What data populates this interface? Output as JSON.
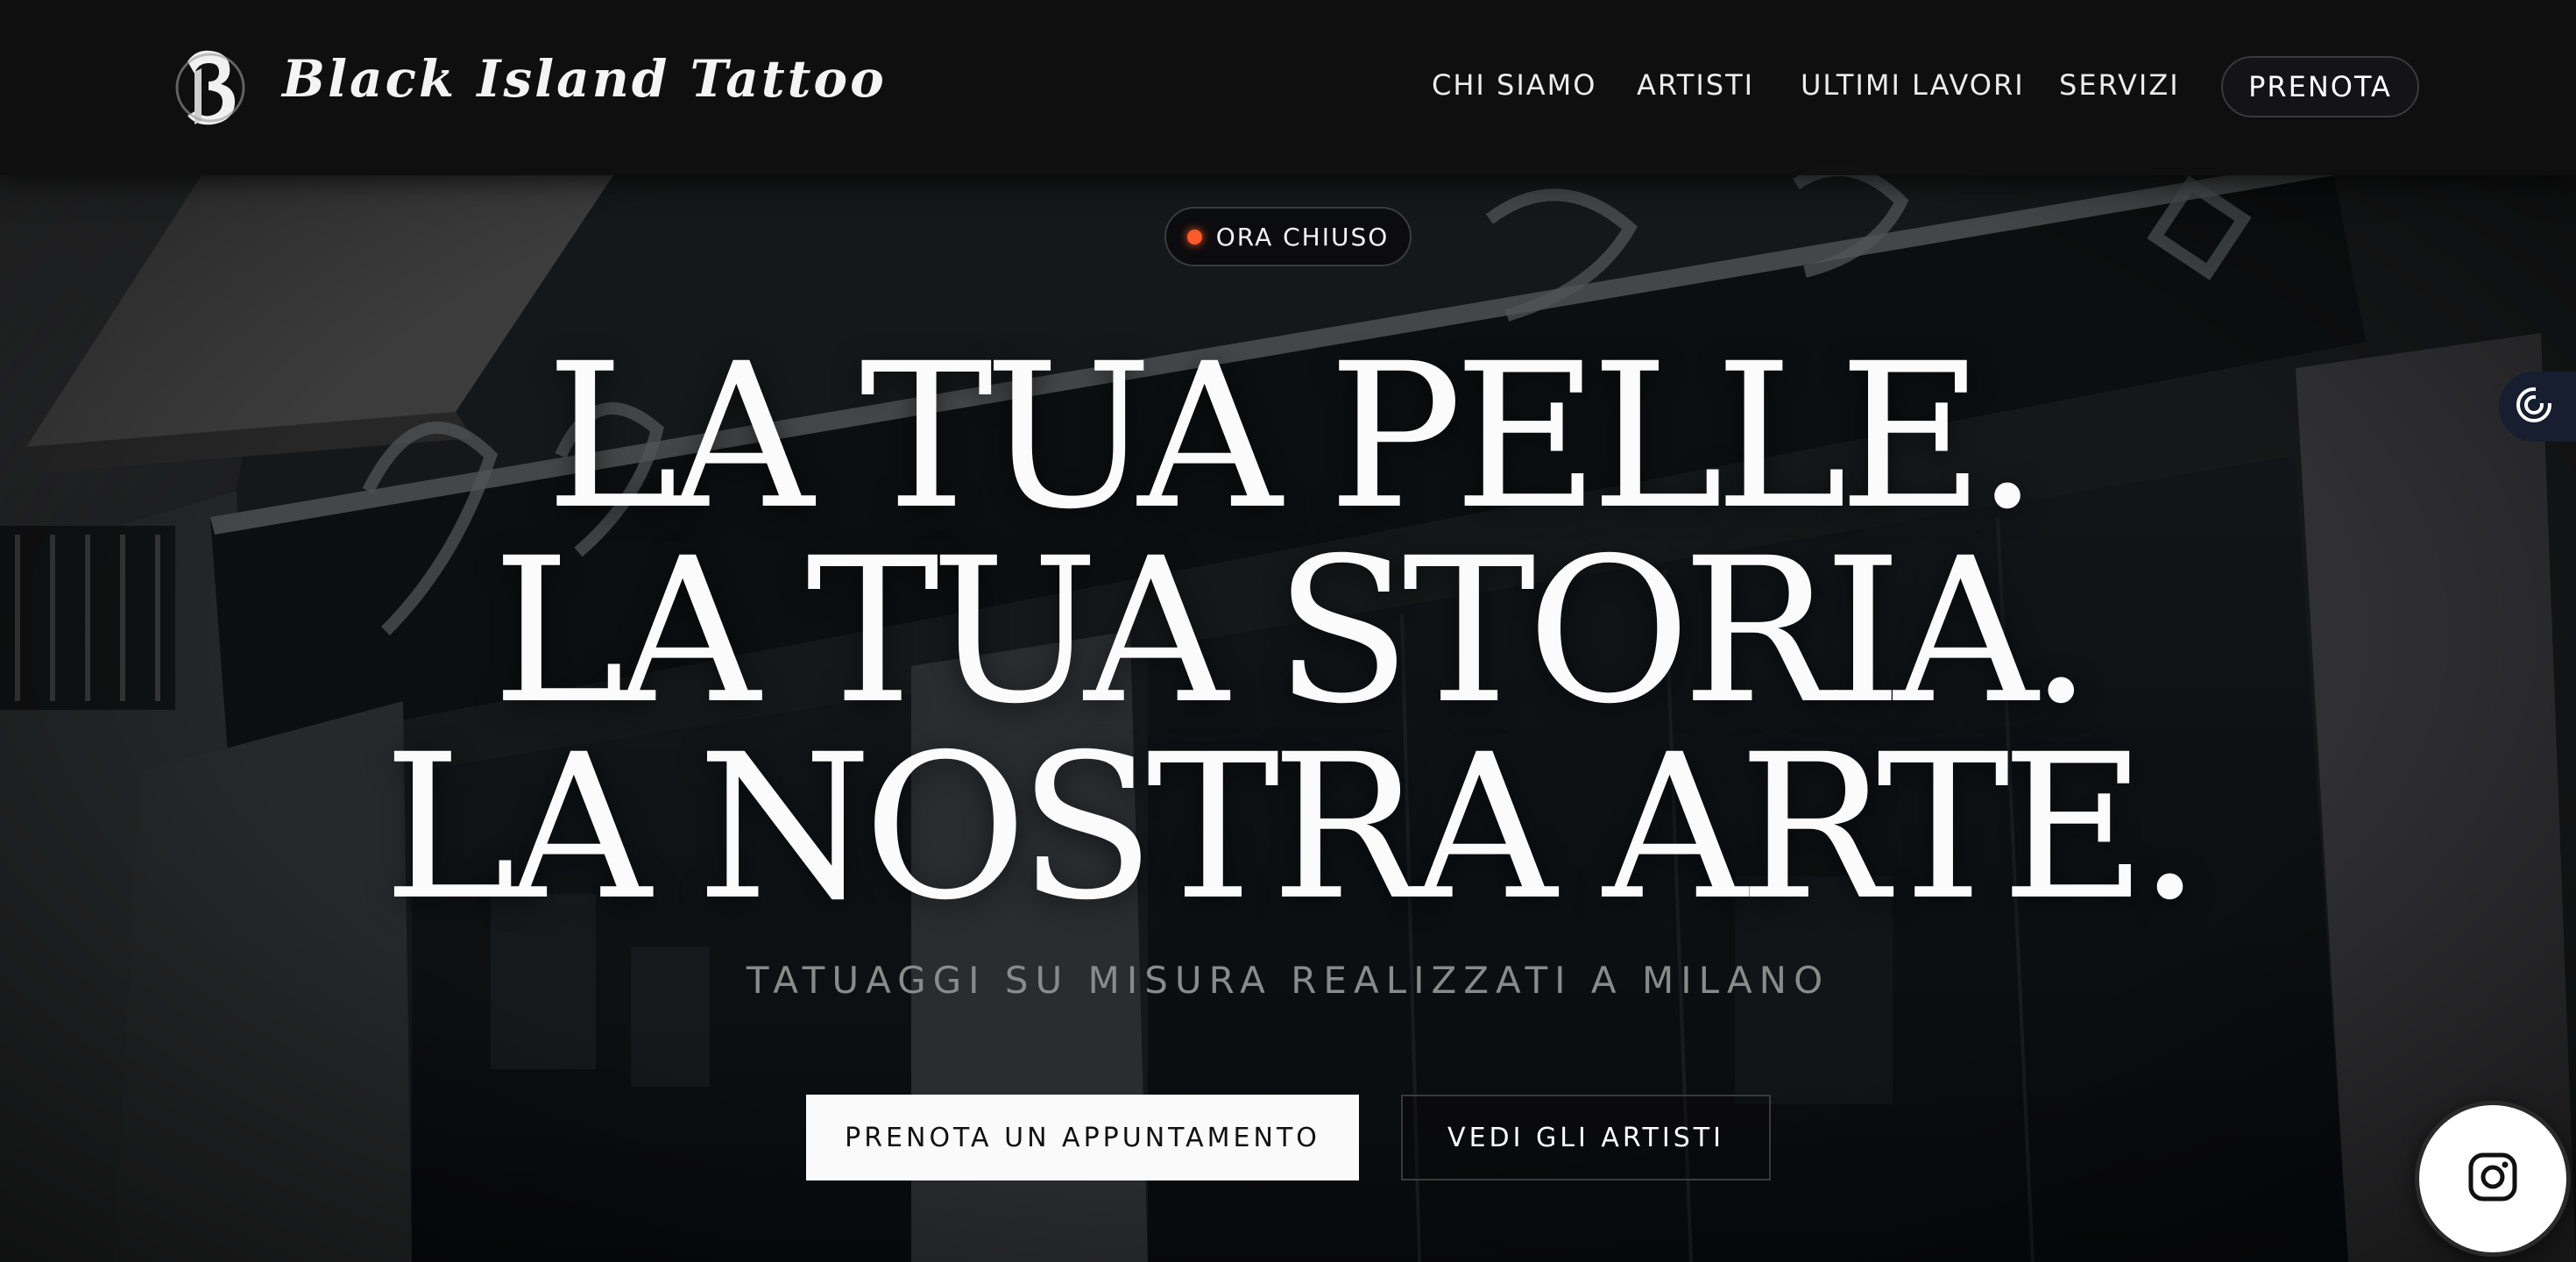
{
  "brand": {
    "name": "Black Island Tattoo",
    "logo_icon": "gothic-b-emblem-icon"
  },
  "nav": {
    "links": [
      {
        "label": "CHI SIAMO"
      },
      {
        "label": "ARTISTI"
      },
      {
        "label": "ULTIMI LAVORI"
      },
      {
        "label": "SERVIZI"
      }
    ],
    "cta_label": "PRENOTA"
  },
  "status": {
    "label": "ORA CHIUSO",
    "dot_color": "#ff5a2a"
  },
  "hero": {
    "headline": [
      "LA TUA PELLE.",
      "LA TUA STORIA.",
      "LA NOSTRA ARTE."
    ],
    "subtitle": "TATUAGGI SU MISURA REALIZZATI A MILANO",
    "primary_cta": "PRENOTA UN APPUNTAMENTO",
    "secondary_cta": "VEDI GLI ARTISTI",
    "background": "storefront-photo"
  },
  "widgets": {
    "side_tab_icon": "consent-settings-icon",
    "floating_icon": "instagram-icon"
  },
  "colors": {
    "accent": "#ff5a2a",
    "nav_bg": "#101011",
    "button_light": "#fafafa",
    "text_muted": "#8a8a8a"
  }
}
